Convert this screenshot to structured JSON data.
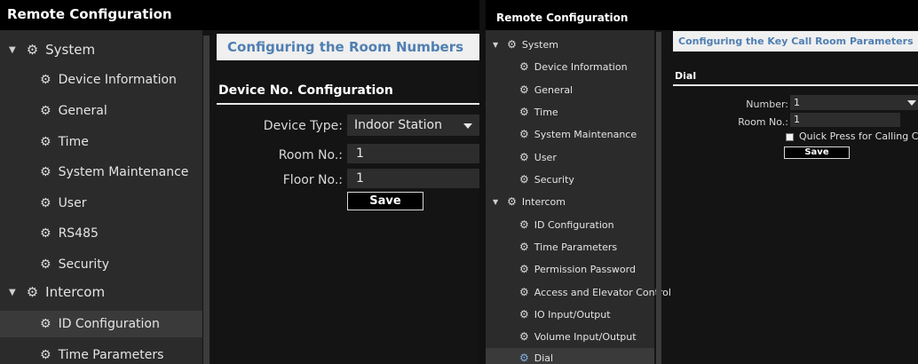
{
  "left": {
    "title": "Remote Configuration",
    "tree": {
      "system": "System",
      "system_items": [
        "Device Information",
        "General",
        "Time",
        "System Maintenance",
        "User",
        "RS485",
        "Security"
      ],
      "intercom": "Intercom",
      "intercom_items": [
        "ID Configuration",
        "Time Parameters"
      ]
    },
    "content": {
      "section_title": "Configuring the Room Numbers",
      "subheading": "Device No. Configuration",
      "fields": {
        "device_type_label": "Device Type:",
        "device_type_value": "Indoor Station",
        "room_no_label": "Room No.:",
        "room_no_value": "1",
        "floor_no_label": "Floor No.:",
        "floor_no_value": "1"
      },
      "save_label": "Save"
    }
  },
  "right": {
    "title": "Remote Configuration",
    "tree": {
      "system": "System",
      "system_items": [
        "Device Information",
        "General",
        "Time",
        "System Maintenance",
        "User",
        "Security"
      ],
      "intercom": "Intercom",
      "intercom_items": [
        "ID Configuration",
        "Time Parameters",
        "Permission Password",
        "Access and Elevator Control",
        "IO Input/Output",
        "Volume Input/Output",
        "Dial"
      ]
    },
    "content": {
      "section_title": "Configuring the Key Call Room Parameters",
      "subheading": "Dial",
      "number_label": "Number:",
      "number_value": "1",
      "room_no_label": "Room No.:",
      "room_no_value": "1",
      "checkbox_label": "Quick Press for Calling Cente",
      "save_label": "Save"
    }
  }
}
